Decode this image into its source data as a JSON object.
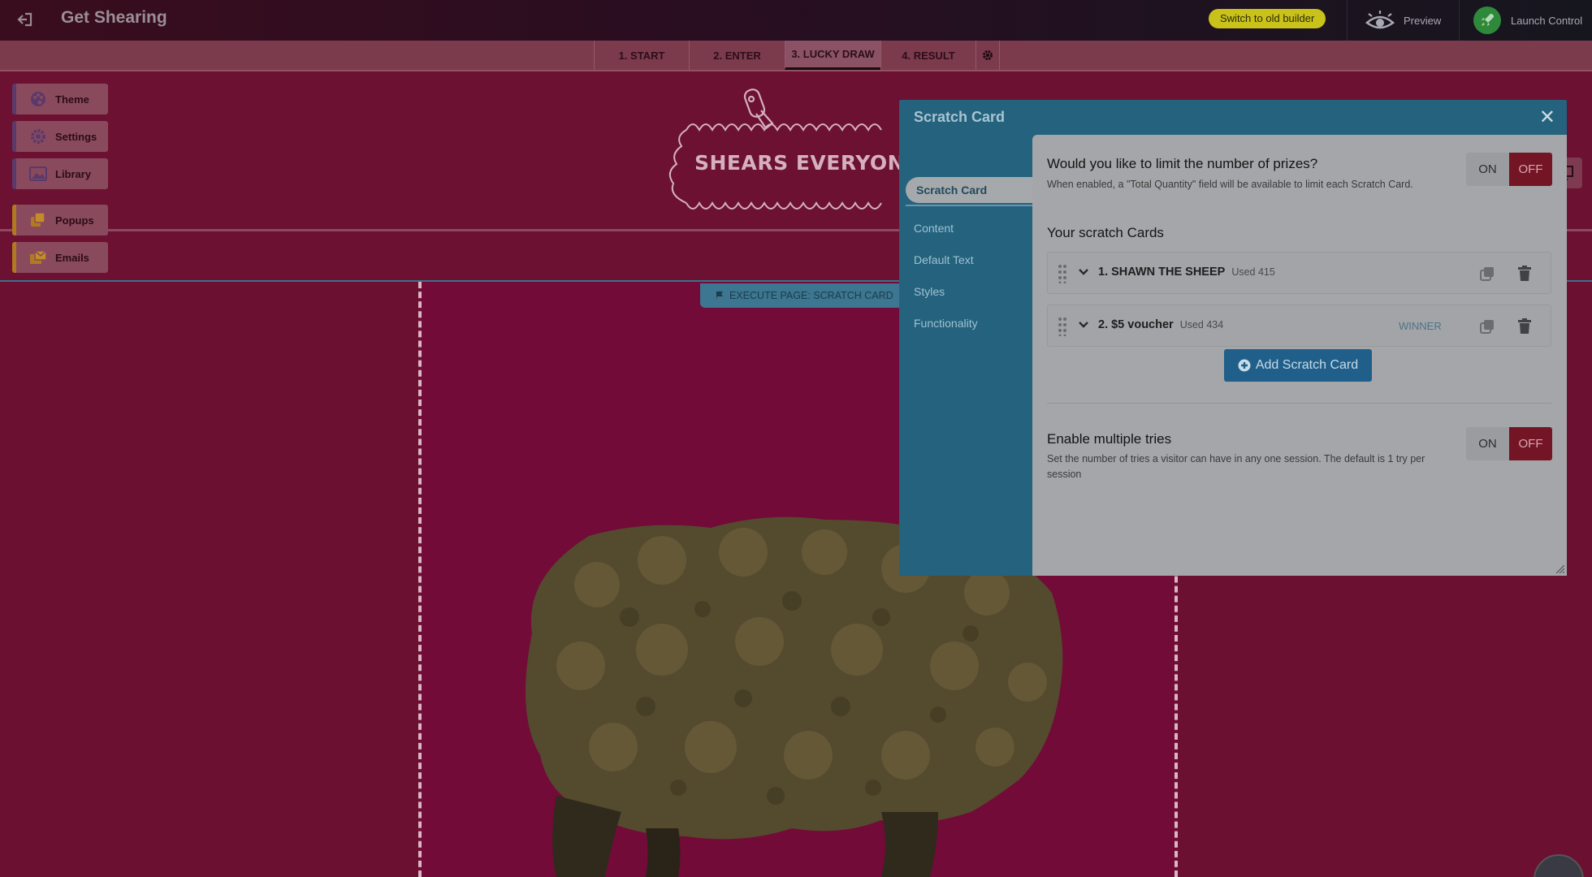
{
  "topbar": {
    "app_title": "Get Shearing",
    "old_builder_label": "Switch to old builder",
    "preview_label": "Preview",
    "launch_label": "Launch Control"
  },
  "steps": [
    {
      "label": "1. START"
    },
    {
      "label": "2. ENTER"
    },
    {
      "label": "3. LUCKY DRAW"
    },
    {
      "label": "4. RESULT"
    }
  ],
  "dock": {
    "theme": "Theme",
    "settings": "Settings",
    "library": "Library",
    "popups": "Popups",
    "emails": "Emails"
  },
  "canvas": {
    "logo_text": "SHEARS EVERYONE",
    "exec_tag": "EXECUTE PAGE: SCRATCH CARD"
  },
  "modal": {
    "title": "Scratch Card",
    "nav": [
      {
        "label": "Scratch Card"
      },
      {
        "label": "Content"
      },
      {
        "label": "Default Text"
      },
      {
        "label": "Styles"
      },
      {
        "label": "Functionality"
      }
    ],
    "limit_prizes": {
      "title": "Would you like to limit the number of prizes?",
      "desc": "When enabled, a \"Total Quantity\" field will be available to limit each Scratch Card.",
      "on": "ON",
      "off": "OFF"
    },
    "cards_title": "Your scratch Cards",
    "cards": [
      {
        "name": "1. SHAWN THE SHEEP",
        "used": "Used 415",
        "badge": ""
      },
      {
        "name": "2. $5 voucher",
        "used": "Used 434",
        "badge": "WINNER"
      }
    ],
    "add_card_label": "Add Scratch Card",
    "multiple_tries": {
      "title": "Enable multiple tries",
      "desc": "Set the number of tries a visitor can have in any one session. The default is 1 try per session",
      "on": "ON",
      "off": "OFF"
    }
  },
  "colors": {
    "accent_off": "#731525",
    "modal_blue": "#24627e",
    "canvas_bg": "#6b1030",
    "old_builder_yellow": "#c8c21a"
  }
}
